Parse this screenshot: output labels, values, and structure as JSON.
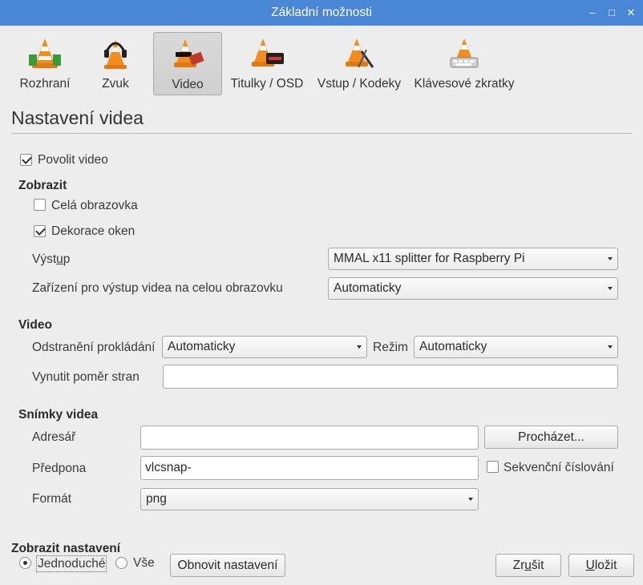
{
  "window": {
    "title": "Základní možnosti",
    "controls": {
      "minimize": "‒",
      "maximize": "□",
      "close": "✕"
    }
  },
  "categories": [
    {
      "label": "Rozhraní",
      "icon": "vlc-cone-interface-icon",
      "active": false
    },
    {
      "label": "Zvuk",
      "icon": "vlc-cone-headphones-icon",
      "active": false
    },
    {
      "label": "Video",
      "icon": "vlc-cone-video-icon",
      "active": true
    },
    {
      "label": "Titulky / OSD",
      "icon": "vlc-cone-subtitles-icon",
      "active": false
    },
    {
      "label": "Vstup / Kodeky",
      "icon": "vlc-cone-input-icon",
      "active": false
    },
    {
      "label": "Klávesové zkratky",
      "icon": "vlc-cone-hotkeys-icon",
      "active": false
    }
  ],
  "page": {
    "title": "Nastavení videa"
  },
  "enable_video": {
    "label": "Povolit video",
    "checked": true
  },
  "display": {
    "heading": "Zobrazit",
    "fullscreen": {
      "label": "Celá obrazovka",
      "checked": false
    },
    "decorations": {
      "label": "Dekorace oken",
      "checked": true
    },
    "output": {
      "label_pre": "Výst",
      "label_acc": "u",
      "label_post": "p",
      "value": "MMAL x11 splitter for Raspberry Pi"
    },
    "fullscreen_device": {
      "label": "Zařízení pro výstup videa na celou obrazovku",
      "value": "Automaticky"
    }
  },
  "video": {
    "heading": "Video",
    "deinterlace": {
      "label": "Odstranění prokládání",
      "value": "Automaticky"
    },
    "mode": {
      "label": "Režim",
      "value": "Automaticky"
    },
    "aspect": {
      "label": "Vynutit poměr stran",
      "value": ""
    }
  },
  "snapshots": {
    "heading": "Snímky videa",
    "directory": {
      "label": "Adresář",
      "value": ""
    },
    "browse_button": "Procházet...",
    "prefix": {
      "label": "Předpona",
      "value": "vlcsnap-"
    },
    "sequential": {
      "label": "Sekvenční číslování",
      "checked": false
    },
    "format": {
      "label": "Formát",
      "value": "png"
    }
  },
  "footer": {
    "heading": "Zobrazit nastavení",
    "simple": {
      "label": "Jednoduché",
      "selected": true
    },
    "all": {
      "label": "Vše",
      "selected": false
    },
    "reset_button": "Obnovit nastavení",
    "cancel": {
      "pre": "Zr",
      "acc": "u",
      "post": "šit"
    },
    "save": {
      "pre": "",
      "acc": "U",
      "post": "ložit"
    }
  },
  "colors": {
    "titlebar": "#4a86d6",
    "background": "#ededed",
    "cone_orange": "#f28c1e"
  }
}
